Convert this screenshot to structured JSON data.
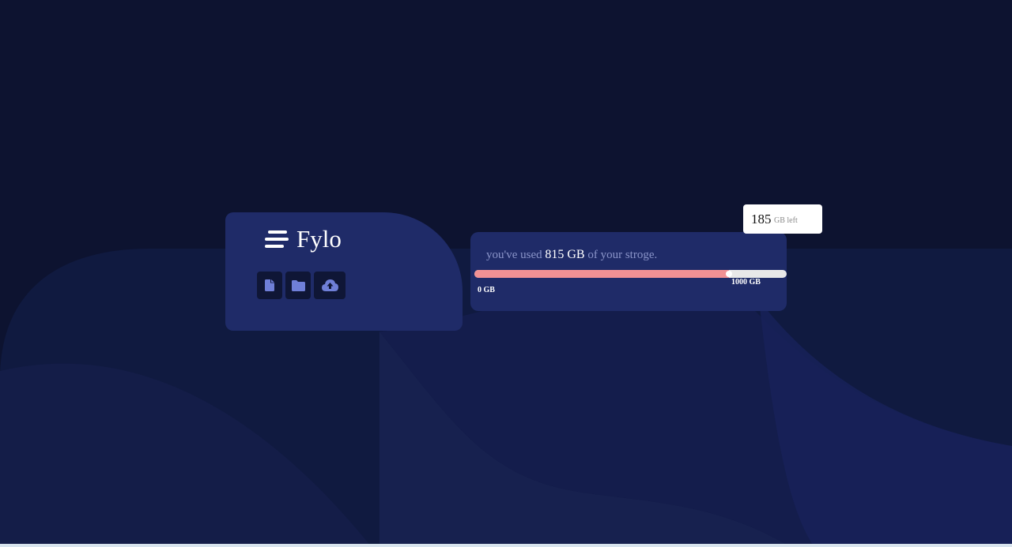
{
  "brand": {
    "name": "Fylo"
  },
  "toolbar": {
    "icons": [
      {
        "name": "document-icon",
        "color": "#6f7fd8"
      },
      {
        "name": "folder-icon",
        "color": "#6f7fd8"
      },
      {
        "name": "upload-icon",
        "color": "#6f7fd8"
      }
    ]
  },
  "storage": {
    "prefix": "you've used",
    "amount": "815 GB",
    "suffix": "of your stroge.",
    "min_label": "0 GB",
    "max_label": "1000 GB",
    "used_fraction": 0.815,
    "fill_color": "#f19194"
  },
  "callout": {
    "number": "185",
    "unit": "GB left"
  },
  "colors": {
    "background": "#0d1330",
    "card": "#1f2b68",
    "accent_text": "#8a94c9"
  }
}
